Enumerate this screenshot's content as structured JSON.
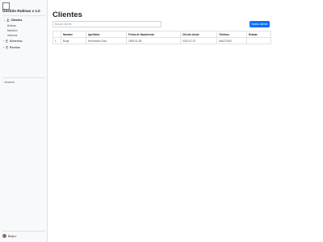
{
  "app": {
    "title": "Gestión Rutinas v 1.0"
  },
  "sidebar": {
    "groups": [
      {
        "label": "Clientes",
        "icon": "person-icon",
        "active": true,
        "items": [
          "Rutinas",
          "Medición",
          "Informes"
        ]
      },
      {
        "label": "Alimentos",
        "icon": "calendar-icon",
        "active": false,
        "items": []
      },
      {
        "label": "Recetas",
        "icon": "person-circle-icon",
        "active": false,
        "items": []
      }
    ],
    "account_label": "Account",
    "user_name": "Borja"
  },
  "main": {
    "title": "Clientes",
    "search_placeholder": "Buscar cliente",
    "new_button_label": "Nuevo cliente",
    "table": {
      "columns": [
        "",
        "Nombre",
        "Apellidos",
        "Fecha de Nacimiento",
        "Cliente desde",
        "Telefono",
        "Estado"
      ],
      "rows": [
        [
          "1",
          "Borja",
          "Hernández Díaz",
          "1995-01-08",
          "2022-07-07",
          "646271542",
          ""
        ]
      ]
    }
  },
  "colors": {
    "accent": "#0d6efd",
    "sidebar_bg": "#f8f9fa",
    "border": "#dee2e6"
  }
}
